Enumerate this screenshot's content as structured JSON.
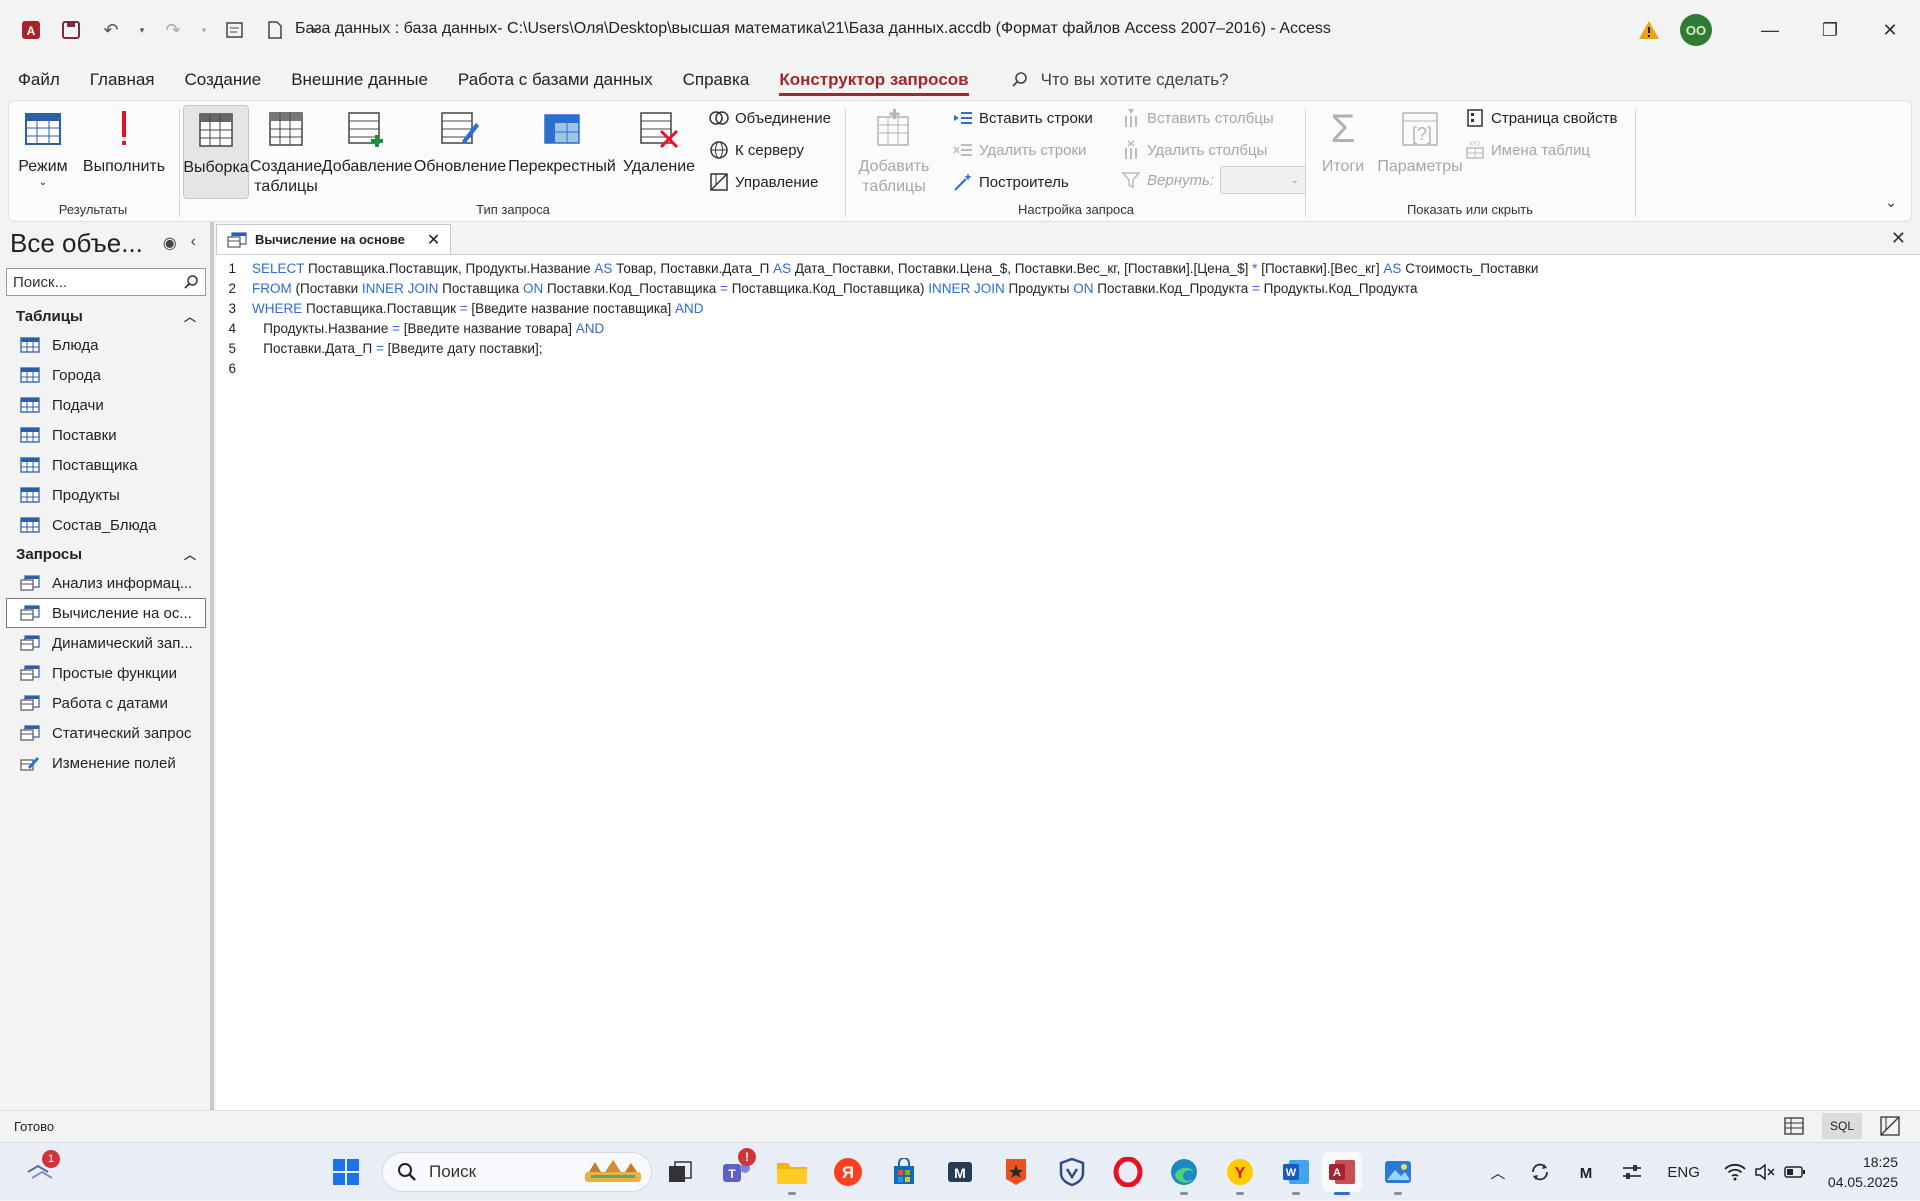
{
  "titlebar": {
    "title": "База данных : база данных- C:\\Users\\Оля\\Desktop\\высшая математика\\21\\База данных.accdb (Формат файлов Access 2007–2016)  -  Access",
    "avatar": "OO"
  },
  "menu": {
    "tabs": [
      "Файл",
      "Главная",
      "Создание",
      "Внешние данные",
      "Работа с базами данных",
      "Справка",
      "Конструктор запросов"
    ],
    "active": "Конструктор запросов",
    "search_placeholder": "Что вы хотите сделать?"
  },
  "ribbon": {
    "results": {
      "label": "Результаты",
      "mode": "Режим",
      "run": "Выполнить"
    },
    "query_type": {
      "label": "Тип запроса",
      "select": "Выборка",
      "make_table_1": "Создание",
      "make_table_2": "таблицы",
      "append": "Добавление",
      "update": "Обновление",
      "crosstab": "Перекрестный",
      "delete": "Удаление",
      "union": "Объединение",
      "pass_through": "К серверу",
      "data_definition": "Управление"
    },
    "query_setup": {
      "label": "Настройка запроса",
      "add_tables_1": "Добавить",
      "add_tables_2": "таблицы",
      "insert_rows": "Вставить строки",
      "delete_rows": "Удалить строки",
      "builder": "Построитель",
      "insert_columns": "Вставить столбцы",
      "delete_columns": "Удалить столбцы",
      "return": "Вернуть:"
    },
    "show_hide": {
      "label": "Показать или скрыть",
      "totals": "Итоги",
      "parameters": "Параметры",
      "property_sheet": "Страница свойств",
      "table_names": "Имена таблиц"
    }
  },
  "nav": {
    "title": "Все объе...",
    "search_placeholder": "Поиск...",
    "tables_label": "Таблицы",
    "tables": [
      "Блюда",
      "Города",
      "Подачи",
      "Поставки",
      "Поставщика",
      "Продукты",
      "Состав_Блюда"
    ],
    "queries_label": "Запросы",
    "queries": [
      "Анализ информац...",
      "Вычисление на ос...",
      "Динамический зап...",
      "Простые функции",
      "Работа с датами",
      "Статический запрос",
      "Изменение полей"
    ]
  },
  "document": {
    "tab_label": "Вычисление на основе",
    "sql_lines": [
      [
        [
          "k",
          "SELECT"
        ],
        [
          "t",
          " Поставщика.Поставщик, Продукты.Название "
        ],
        [
          "k",
          "AS"
        ],
        [
          "t",
          " Товар, Поставки.Дата_П "
        ],
        [
          "k",
          "AS"
        ],
        [
          "t",
          " Дата_Поставки, Поставки.Цена_$, Поставки.Вес_кг, [Поставки].[Цена_$] "
        ],
        [
          "k",
          "*"
        ],
        [
          "t",
          " [Поставки].[Вес_кг] "
        ],
        [
          "k",
          "AS"
        ],
        [
          "t",
          " Стоимость_Поставки"
        ]
      ],
      [
        [
          "k",
          "FROM"
        ],
        [
          "t",
          " (Поставки "
        ],
        [
          "k",
          "INNER JOIN"
        ],
        [
          "t",
          " Поставщика "
        ],
        [
          "k",
          "ON"
        ],
        [
          "t",
          " Поставки.Код_Поставщика "
        ],
        [
          "k",
          "="
        ],
        [
          "t",
          " Поставщика.Код_Поставщика) "
        ],
        [
          "k",
          "INNER JOIN"
        ],
        [
          "t",
          " Продукты "
        ],
        [
          "k",
          "ON"
        ],
        [
          "t",
          " Поставки.Код_Продукта "
        ],
        [
          "k",
          "="
        ],
        [
          "t",
          " Продукты.Код_Продукта"
        ]
      ],
      [
        [
          "k",
          "WHERE"
        ],
        [
          "t",
          " Поставщика.Поставщик "
        ],
        [
          "k",
          "="
        ],
        [
          "t",
          " [Введите название поставщика] "
        ],
        [
          "k",
          "AND"
        ]
      ],
      [
        [
          "t",
          "   Продукты.Название "
        ],
        [
          "k",
          "="
        ],
        [
          "t",
          " [Введите название товара] "
        ],
        [
          "k",
          "AND"
        ]
      ],
      [
        [
          "t",
          "   Поставки.Дата_П "
        ],
        [
          "k",
          "="
        ],
        [
          "t",
          " [Введите дату поставки];"
        ]
      ],
      []
    ]
  },
  "status": {
    "text": "Готово",
    "sql_view": "SQL"
  },
  "taskbar": {
    "search_placeholder": "Поиск",
    "widgets_badge": "1",
    "teams_badge": "!",
    "lang": "ENG",
    "time": "18:25",
    "date": "04.05.2025"
  },
  "colors": {
    "accent": "#a4262c",
    "keyword": "#2d6bd8",
    "access": "#a4262c"
  }
}
